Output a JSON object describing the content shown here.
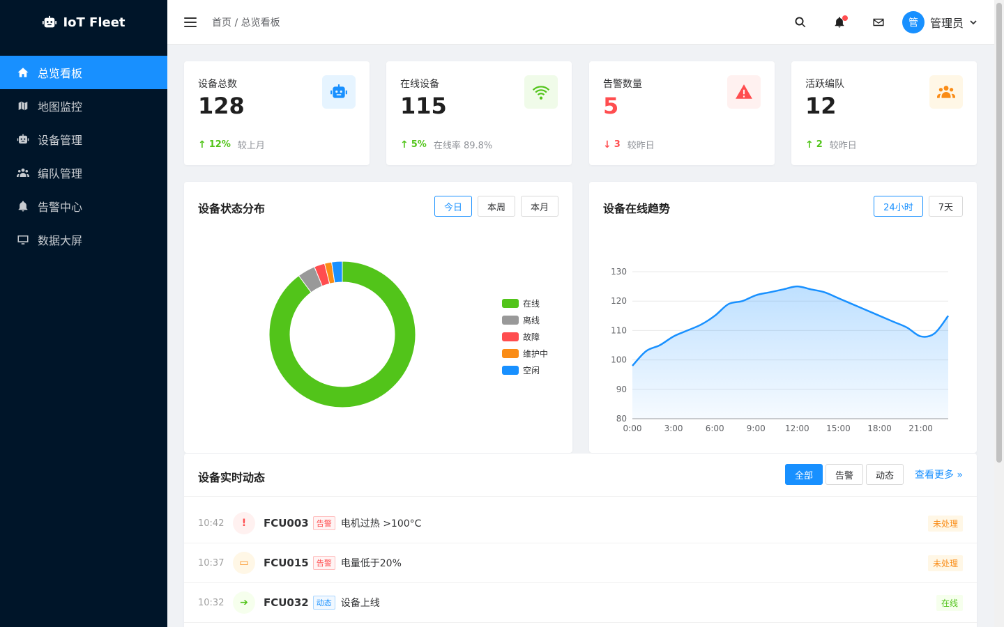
{
  "app": {
    "title": "IoT Fleet",
    "logo_icon": "robot-icon"
  },
  "sidebar": {
    "items": [
      {
        "label": "总览看板",
        "icon": "home-icon",
        "active": true
      },
      {
        "label": "地图监控",
        "icon": "map-icon",
        "active": false
      },
      {
        "label": "设备管理",
        "icon": "robot-icon",
        "active": false
      },
      {
        "label": "编队管理",
        "icon": "users-icon",
        "active": false
      },
      {
        "label": "告警中心",
        "icon": "bell-icon",
        "active": false
      },
      {
        "label": "数据大屏",
        "icon": "monitor-icon",
        "active": false
      }
    ]
  },
  "header": {
    "breadcrumb": "首页 / 总览看板",
    "icons": [
      "search-icon",
      "bell-icon",
      "mail-icon"
    ],
    "has_notification": true,
    "user": {
      "avatar_text": "管",
      "name": "管理员"
    }
  },
  "stats": [
    {
      "label": "设备总数",
      "value": "128",
      "change_dir": "up",
      "change": "12%",
      "note": "较上月",
      "icon": "robot-icon",
      "icon_color": "#1890ff",
      "icon_bg": "#e6f4ff",
      "value_color": "#1f1f1f"
    },
    {
      "label": "在线设备",
      "value": "115",
      "change_dir": "up",
      "change": "5%",
      "note": "在线率 89.8%",
      "icon": "wifi-icon",
      "icon_color": "#52c41a",
      "icon_bg": "#f0fbe9",
      "value_color": "#1f1f1f"
    },
    {
      "label": "告警数量",
      "value": "5",
      "change_dir": "down",
      "change": "3",
      "note": "较昨日",
      "icon": "warning-icon",
      "icon_color": "#ff4d4f",
      "icon_bg": "#fff1f0",
      "value_color": "#ff4d4f"
    },
    {
      "label": "活跃编队",
      "value": "12",
      "change_dir": "up",
      "change": "2",
      "note": "较昨日",
      "icon": "users-icon",
      "icon_color": "#fa8c16",
      "icon_bg": "#fff7e6",
      "value_color": "#1f1f1f"
    }
  ],
  "status_panel": {
    "title": "设备状态分布",
    "buttons": [
      "今日",
      "本周",
      "本月"
    ],
    "active_button": 0
  },
  "trend_panel": {
    "title": "设备在线趋势",
    "buttons": [
      "24小时",
      "7天"
    ],
    "active_button": 0
  },
  "chart_data": [
    {
      "type": "pie",
      "variant": "donut",
      "categories": [
        "在线",
        "离线",
        "故障",
        "维护中",
        "空闲"
      ],
      "values": [
        115,
        5,
        3,
        2,
        3
      ],
      "colors": [
        "#52c41a",
        "#999999",
        "#ff4d4f",
        "#fa8c16",
        "#1890ff"
      ],
      "legend": "right"
    },
    {
      "type": "area",
      "x": [
        "0:00",
        "1:00",
        "2:00",
        "3:00",
        "4:00",
        "5:00",
        "6:00",
        "7:00",
        "8:00",
        "9:00",
        "10:00",
        "11:00",
        "12:00",
        "13:00",
        "14:00",
        "15:00",
        "16:00",
        "17:00",
        "18:00",
        "19:00",
        "20:00",
        "21:00",
        "22:00",
        "23:00"
      ],
      "xticks": [
        "0:00",
        "3:00",
        "6:00",
        "9:00",
        "12:00",
        "15:00",
        "18:00",
        "21:00"
      ],
      "series": [
        {
          "values": [
            98,
            103,
            105,
            108,
            110,
            112,
            115,
            119,
            120,
            122,
            123,
            124,
            125,
            124,
            123,
            121,
            119,
            117,
            115,
            113,
            111,
            108,
            109,
            115
          ]
        }
      ],
      "ylim": [
        80,
        130
      ],
      "yticks": [
        80,
        90,
        100,
        110,
        120,
        130
      ],
      "grid": true,
      "color": "#1890ff"
    }
  ],
  "feed": {
    "title": "设备实时动态",
    "filters": [
      "全部",
      "告警",
      "动态"
    ],
    "active_filter": 0,
    "more_link": "查看更多 »",
    "items": [
      {
        "time": "10:42",
        "icon": "alert-icon",
        "icon_glyph": "!",
        "icon_color": "#ff4d4f",
        "icon_bg": "#fff1f0",
        "device": "FCU003",
        "tag": "告警",
        "tag_color": "#ff4d4f",
        "message": "电机过热 >100°C",
        "status": "未处理",
        "status_color": "#fa8c16",
        "status_bg": "#fff7e6"
      },
      {
        "time": "10:37",
        "icon": "battery-icon",
        "icon_glyph": "▭",
        "icon_color": "#fa8c16",
        "icon_bg": "#fff7e6",
        "device": "FCU015",
        "tag": "告警",
        "tag_color": "#ff4d4f",
        "message": "电量低于20%",
        "status": "未处理",
        "status_color": "#fa8c16",
        "status_bg": "#fff7e6"
      },
      {
        "time": "10:32",
        "icon": "login-icon",
        "icon_glyph": "➔",
        "icon_color": "#52c41a",
        "icon_bg": "#f6ffed",
        "device": "FCU032",
        "tag": "动态",
        "tag_color": "#1890ff",
        "message": "设备上线",
        "status": "在线",
        "status_color": "#52c41a",
        "status_bg": "#f6ffed"
      }
    ]
  }
}
